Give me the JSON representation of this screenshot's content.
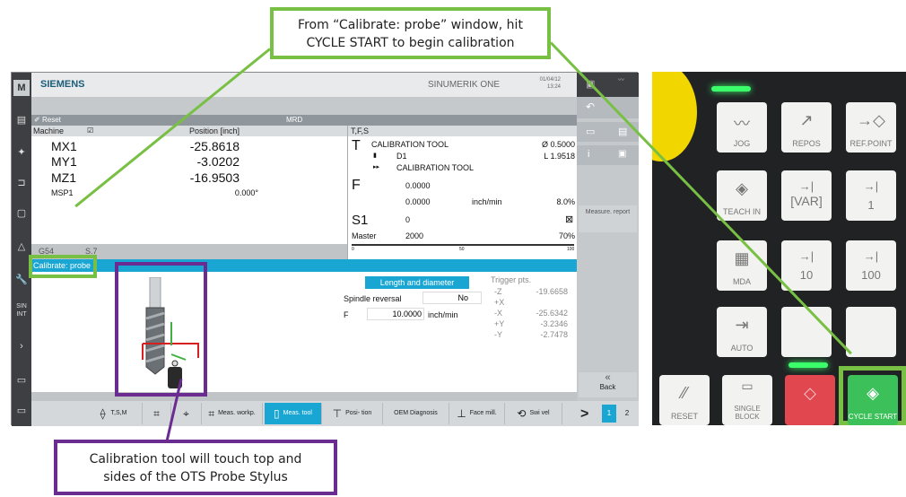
{
  "callouts": {
    "top": [
      "From “Calibrate: probe” window, hit",
      "CYCLE START to begin calibration"
    ],
    "bottom": [
      "Calibration tool will touch top and",
      "sides of the OTS Probe Stylus"
    ]
  },
  "colors": {
    "accent_green": "#78c043",
    "accent_purple": "#6a2c91",
    "hmi_blue": "#1aa6d3",
    "cycle_start_green": "#3cc05a"
  },
  "hmi": {
    "brand": "SIEMENS",
    "product": "SINUMERIK ONE",
    "date": "01/04/12",
    "time": "13:24",
    "status": {
      "reset": "Reset",
      "mode": "MRD"
    },
    "left_icons": [
      "machine-icon",
      "program-manager-icon",
      "settings-icon",
      "program-icon",
      "files-icon",
      "alarm-icon",
      "wrench-icon",
      "sinumerik-integrate-icon",
      "expand-icon",
      "window-icon",
      "monitor-icon"
    ],
    "position_panel": {
      "col1": "Machine",
      "col2": "Position [inch]",
      "axes": [
        {
          "name": "MX1",
          "value": "-25.8618"
        },
        {
          "name": "MY1",
          "value": "-3.0202"
        },
        {
          "name": "MZ1",
          "value": "-16.9503"
        }
      ],
      "spindle": {
        "name": "MSP1",
        "value": "0.000°"
      }
    },
    "tfs": {
      "header": "T,F,S",
      "t_label": "T",
      "tool": "CALIBRATION TOOL",
      "diameter": "Ø 0.5000",
      "d": "D1",
      "length": "L 1.9518",
      "next_tool": "CALIBRATION TOOL",
      "f_label": "F",
      "f_value": "0.0000",
      "f_actual": "0.0000",
      "f_unit": "inch/min",
      "f_override": "8.0%",
      "s_label": "S1",
      "s_value": "0",
      "master_label": "Master",
      "master_value": "2000",
      "master_override": "70%",
      "scale": [
        "0",
        "50",
        "100"
      ]
    },
    "wcs": {
      "offset": "G54",
      "program": "S.7"
    },
    "window_title": "Calibrate: probe",
    "form": {
      "mode_button": "Length and diameter",
      "spindle_reversal_label": "Spindle reversal",
      "spindle_reversal_value": "No",
      "f_label": "F",
      "f_value": "10.0000",
      "f_unit": "inch/min",
      "trigger_title": "Trigger pts.",
      "trigger_points": [
        {
          "axis": "-Z",
          "value": "-19.6658"
        },
        {
          "axis": "+X",
          "value": ""
        },
        {
          "axis": "-X",
          "value": "-25.6342"
        },
        {
          "axis": "+Y",
          "value": "-3.2346"
        },
        {
          "axis": "-Y",
          "value": "-2.7478"
        }
      ]
    },
    "vertical_softkeys": {
      "measure_report": "Measure. report",
      "back_arrows": "«",
      "back": "Back"
    },
    "softkeys": [
      {
        "label": "T,S,M",
        "icon": "tsm-icon"
      },
      {
        "label": "",
        "icon": "meas-icon-1"
      },
      {
        "label": "",
        "icon": "meas-icon-2"
      },
      {
        "label": "Meas. workp.",
        "icon": "meas-workpiece-icon"
      },
      {
        "label": "Meas. tool",
        "icon": "meas-tool-icon",
        "active": true
      },
      {
        "label": "Posi- tion",
        "icon": "position-icon"
      },
      {
        "label": "OEM Diagnosis",
        "icon": ""
      },
      {
        "label": "Face mill.",
        "icon": "face-mill-icon"
      },
      {
        "label": "Swi vel",
        "icon": "swivel-icon"
      }
    ],
    "pager": {
      "arrow": ">",
      "page1": "1",
      "page2": "2"
    }
  },
  "keypad": {
    "keys": [
      {
        "label": "JOG",
        "icon": "jog-icon"
      },
      {
        "label": "REPOS",
        "icon": "repos-icon"
      },
      {
        "label": "REF.POINT",
        "icon": "ref-point-icon"
      },
      {
        "label": "TEACH IN",
        "icon": "teach-in-icon"
      },
      {
        "label": "",
        "icon": "var-icon",
        "text": "[VAR]"
      },
      {
        "label": "1",
        "icon": "increment-1-icon"
      },
      {
        "label": "MDA",
        "icon": "mda-icon"
      },
      {
        "label": "10",
        "icon": "increment-10-icon"
      },
      {
        "label": "100",
        "icon": "increment-100-icon"
      },
      {
        "label": "AUTO",
        "icon": "auto-icon"
      },
      {
        "label": "",
        "icon": "blank-key"
      },
      {
        "label": "",
        "icon": "blank-key"
      },
      {
        "label": "RESET",
        "icon": "reset-icon"
      },
      {
        "label": "SINGLE BLOCK",
        "icon": "single-block-icon"
      },
      {
        "label": "",
        "icon": "cycle-stop-icon"
      },
      {
        "label": "CYCLE START",
        "icon": "cycle-start-icon"
      }
    ]
  }
}
